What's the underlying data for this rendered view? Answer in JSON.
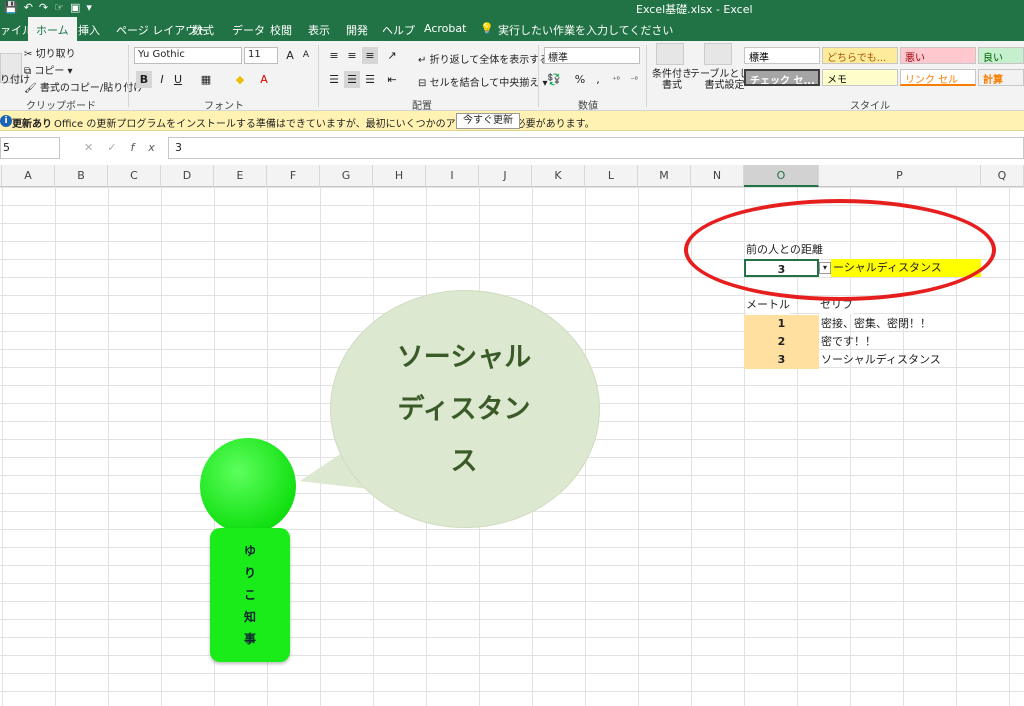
{
  "window": {
    "qat_icons": [
      "save-icon",
      "undo-icon",
      "redo-icon",
      "touch-mode-icon",
      "screenshot-icon",
      "customize-icon"
    ],
    "title": "Excel基礎.xlsx - Excel"
  },
  "tabs": [
    {
      "label": "ァイル"
    },
    {
      "label": "ホーム"
    },
    {
      "label": "挿入"
    },
    {
      "label": "ページ レイアウト"
    },
    {
      "label": "数式"
    },
    {
      "label": "データ"
    },
    {
      "label": "校閲"
    },
    {
      "label": "表示"
    },
    {
      "label": "開発"
    },
    {
      "label": "ヘルプ"
    },
    {
      "label": "Acrobat"
    }
  ],
  "tell_me": "実行したい作業を入力してください",
  "ribbon": {
    "clipboard": {
      "paste": "り付け",
      "cut": "切り取り",
      "copy": "コピー",
      "format_painter": "書式のコピー/貼り付け",
      "label": "クリップボード"
    },
    "font": {
      "family": "Yu Gothic",
      "size": "11",
      "grow": "A",
      "shrink": "A",
      "bold": "B",
      "italic": "I",
      "underline": "U",
      "label": "フォント"
    },
    "alignment": {
      "wrap": "折り返して全体を表示する",
      "merge": "セルを結合して中央揃え",
      "label": "配置"
    },
    "number": {
      "format": "標準",
      "percent": "%",
      "comma": ",",
      "label": "数値"
    },
    "styles": {
      "conditional": "条件付き\n書式",
      "table": "テーブルとして\n書式設定",
      "cells": [
        {
          "label": "標準",
          "bg": "#ffffff",
          "fg": "#000000"
        },
        {
          "label": "どちらでも...",
          "bg": "#ffeb9c",
          "fg": "#9c5700"
        },
        {
          "label": "悪い",
          "bg": "#ffc7ce",
          "fg": "#9c0006"
        },
        {
          "label": "良い",
          "bg": "#c6efce",
          "fg": "#006100"
        },
        {
          "label": "チェック セ...",
          "bg": "#a5a5a5",
          "fg": "#ffffff"
        },
        {
          "label": "メモ",
          "bg": "#ffffcc",
          "fg": "#000000"
        },
        {
          "label": "リンク セル",
          "bg": "#ffffff",
          "fg": "#fa7d00"
        },
        {
          "label": "計算",
          "bg": "#f2f2f2",
          "fg": "#fa7d00"
        }
      ],
      "label": "スタイル"
    }
  },
  "message_bar": {
    "title": "更新あり",
    "text": "Office の更新プログラムをインストールする準備はできていますが、最初にいくつかのアプリを閉じる必要があります。",
    "button": "今すぐ更新"
  },
  "formula_bar": {
    "name_box": "5",
    "cancel": "✕",
    "enter": "✓",
    "fx": "fx",
    "value": "3"
  },
  "columns": [
    "A",
    "B",
    "C",
    "D",
    "E",
    "F",
    "G",
    "H",
    "I",
    "J",
    "K",
    "L",
    "M",
    "N",
    "O",
    "P",
    "Q"
  ],
  "cells": {
    "distance_label": "前の人との距離",
    "distance_value": "3",
    "lookup_result": "ーシャルディスタンス",
    "table_header_left": "メートル",
    "table_header_right": "セリフ",
    "rows": [
      {
        "num": "1",
        "text": "密接、密集、密閉！！"
      },
      {
        "num": "2",
        "text": "密です！！"
      },
      {
        "num": "3",
        "text": "ソーシャルディスタンス"
      }
    ]
  },
  "shapes": {
    "speech_lines": [
      "ソーシャル",
      "ディスタン",
      "ス"
    ],
    "figure_chars": [
      "ゆ",
      "り",
      "こ",
      "知",
      "事"
    ]
  },
  "colors": {
    "excel_green": "#217346",
    "highlight_yellow": "#ffff00",
    "table_orange": "#ffe0a0",
    "circle_red": "#e61e1e",
    "figure_green": "#1aec1a"
  }
}
